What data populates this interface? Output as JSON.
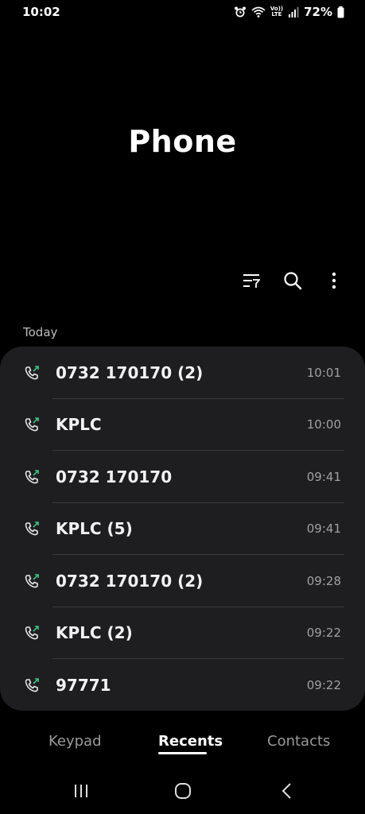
{
  "status_bar": {
    "time": "10:02",
    "battery": "72%",
    "icons": [
      "alarm-icon",
      "wifi-icon",
      "volte-icon",
      "signal-icon",
      "battery-icon"
    ],
    "volte_line1": "Vo))",
    "volte_line2": "LTE"
  },
  "header": {
    "title": "Phone"
  },
  "toolbar": {
    "icons": [
      "filter-icon",
      "search-icon",
      "more-options-icon"
    ]
  },
  "section": {
    "label": "Today"
  },
  "calls": [
    {
      "name": "0732 170170 (2)",
      "time": "10:01"
    },
    {
      "name": "KPLC",
      "time": "10:00"
    },
    {
      "name": "0732 170170",
      "time": "09:41"
    },
    {
      "name": "KPLC (5)",
      "time": "09:41"
    },
    {
      "name": "0732 170170 (2)",
      "time": "09:28"
    },
    {
      "name": "KPLC (2)",
      "time": "09:22"
    },
    {
      "name": "97771",
      "time": "09:22"
    }
  ],
  "tabs": [
    {
      "label": "Keypad",
      "active": false
    },
    {
      "label": "Recents",
      "active": true
    },
    {
      "label": "Contacts",
      "active": false
    }
  ],
  "colors": {
    "background": "#000000",
    "card": "#1e1e21",
    "outgoing_arrow": "#3fbf7f"
  }
}
